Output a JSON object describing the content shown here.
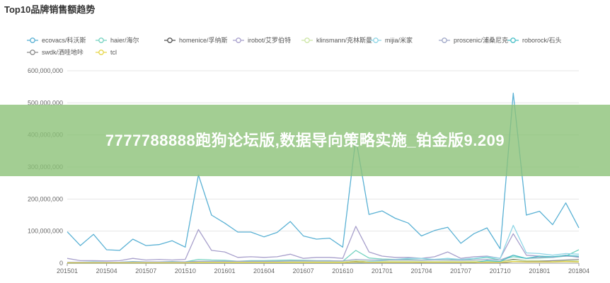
{
  "title": "Top10品牌销售额趋势",
  "banner_text": "7777788888跑狗论坛版,数据导向策略实施_铂金版9.209",
  "chart_data": {
    "type": "line",
    "title": "Top10品牌销售额趋势",
    "xlabel": "",
    "ylabel": "",
    "ylim": [
      0,
      600000000
    ],
    "yticks": [
      0,
      100000000,
      200000000,
      300000000,
      400000000,
      500000000,
      600000000
    ],
    "ytick_labels": [
      "0",
      "100,000,000",
      "200,000,000",
      "300,000,000",
      "400,000,000",
      "500,000,000",
      "600,000,000"
    ],
    "xtick_labels": [
      "201501",
      "201504",
      "201507",
      "201510",
      "201601",
      "201604",
      "201607",
      "201610",
      "201701",
      "201704",
      "201707",
      "201710",
      "201801",
      "201804"
    ],
    "grid": "horizontal",
    "legend_position": "top",
    "x": [
      "201501",
      "201502",
      "201503",
      "201504",
      "201505",
      "201506",
      "201507",
      "201508",
      "201509",
      "201510",
      "201511",
      "201512",
      "201601",
      "201602",
      "201603",
      "201604",
      "201605",
      "201606",
      "201607",
      "201608",
      "201609",
      "201610",
      "201611",
      "201612",
      "201701",
      "201702",
      "201703",
      "201704",
      "201705",
      "201706",
      "201707",
      "201708",
      "201709",
      "201710",
      "201711",
      "201712",
      "201801",
      "201802",
      "201803",
      "201804"
    ],
    "series": [
      {
        "name": "ecovacs/科沃斯",
        "color": "#5ab1d4",
        "values": [
          98000000,
          55000000,
          90000000,
          42000000,
          40000000,
          75000000,
          55000000,
          58000000,
          70000000,
          50000000,
          275000000,
          150000000,
          125000000,
          97000000,
          97000000,
          82000000,
          96000000,
          130000000,
          85000000,
          75000000,
          78000000,
          50000000,
          390000000,
          152000000,
          163000000,
          140000000,
          125000000,
          85000000,
          102000000,
          112000000,
          62000000,
          92000000,
          110000000,
          45000000,
          530000000,
          150000000,
          162000000,
          120000000,
          188000000,
          110000000
        ]
      },
      {
        "name": "haier/海尔",
        "color": "#76d3c1",
        "values": [
          3000000,
          3000000,
          4000000,
          3000000,
          3000000,
          5000000,
          4000000,
          4000000,
          5000000,
          4000000,
          12000000,
          10000000,
          9000000,
          6000000,
          8000000,
          8000000,
          9000000,
          10000000,
          9000000,
          8000000,
          8000000,
          6000000,
          40000000,
          16000000,
          13000000,
          12000000,
          12000000,
          10000000,
          12000000,
          14000000,
          9000000,
          14000000,
          18000000,
          10000000,
          20000000,
          15000000,
          16000000,
          18000000,
          22000000,
          42000000
        ]
      },
      {
        "name": "homenice/孚纳斯",
        "color": "#555555",
        "values": [
          1000000,
          1000000,
          1000000,
          1000000,
          1000000,
          1000000,
          1000000,
          1000000,
          1000000,
          1000000,
          2000000,
          2000000,
          2000000,
          2000000,
          2000000,
          2000000,
          2000000,
          3000000,
          3000000,
          3000000,
          3000000,
          3000000,
          5000000,
          4000000,
          4000000,
          4000000,
          4000000,
          3000000,
          4000000,
          4000000,
          4000000,
          5000000,
          6000000,
          5000000,
          12000000,
          8000000,
          7000000,
          6000000,
          7000000,
          6000000
        ]
      },
      {
        "name": "irobot/艾罗伯特",
        "color": "#a8a0cc",
        "values": [
          15000000,
          8000000,
          8000000,
          7000000,
          8000000,
          15000000,
          10000000,
          12000000,
          10000000,
          12000000,
          105000000,
          40000000,
          35000000,
          18000000,
          20000000,
          18000000,
          20000000,
          28000000,
          15000000,
          18000000,
          18000000,
          15000000,
          115000000,
          35000000,
          22000000,
          18000000,
          18000000,
          15000000,
          20000000,
          35000000,
          15000000,
          20000000,
          22000000,
          15000000,
          92000000,
          25000000,
          22000000,
          18000000,
          25000000,
          18000000
        ]
      },
      {
        "name": "klinsmann/克林斯曼",
        "color": "#cde6a6",
        "values": [
          2000000,
          2000000,
          2000000,
          2000000,
          2000000,
          3000000,
          3000000,
          3000000,
          3000000,
          3000000,
          5000000,
          4000000,
          4000000,
          4000000,
          4000000,
          4000000,
          4000000,
          4000000,
          4000000,
          4000000,
          4000000,
          4000000,
          8000000,
          6000000,
          6000000,
          6000000,
          6000000,
          5000000,
          5000000,
          6000000,
          5000000,
          6000000,
          6000000,
          5000000,
          10000000,
          8000000,
          8000000,
          7000000,
          8000000,
          7000000
        ]
      },
      {
        "name": "mijia/米家",
        "color": "#8fd6e6",
        "values": [
          0,
          0,
          0,
          0,
          0,
          0,
          0,
          0,
          0,
          0,
          0,
          0,
          0,
          0,
          0,
          0,
          0,
          0,
          0,
          0,
          0,
          0,
          0,
          5000000,
          8000000,
          12000000,
          15000000,
          15000000,
          12000000,
          15000000,
          12000000,
          15000000,
          20000000,
          15000000,
          118000000,
          32000000,
          30000000,
          25000000,
          30000000,
          28000000
        ]
      },
      {
        "name": "proscenic/浦桑尼克",
        "color": "#a0a8c8",
        "values": [
          3000000,
          3000000,
          3000000,
          3000000,
          3000000,
          4000000,
          4000000,
          4000000,
          4000000,
          4000000,
          6000000,
          6000000,
          6000000,
          6000000,
          6000000,
          6000000,
          6000000,
          7000000,
          7000000,
          7000000,
          7000000,
          7000000,
          12000000,
          10000000,
          10000000,
          10000000,
          10000000,
          9000000,
          10000000,
          10000000,
          9000000,
          10000000,
          12000000,
          10000000,
          25000000,
          15000000,
          18000000,
          20000000,
          22000000,
          20000000
        ]
      },
      {
        "name": "roborock/石头",
        "color": "#4ac0c8",
        "values": [
          0,
          0,
          0,
          0,
          0,
          0,
          0,
          0,
          0,
          0,
          0,
          0,
          0,
          0,
          0,
          0,
          0,
          0,
          0,
          0,
          0,
          0,
          0,
          0,
          0,
          0,
          0,
          0,
          0,
          0,
          0,
          2000000,
          8000000,
          5000000,
          25000000,
          15000000,
          22000000,
          20000000,
          24000000,
          22000000
        ]
      },
      {
        "name": "swdk/洒哇地咔",
        "color": "#8c8c8c",
        "values": [
          0,
          0,
          0,
          0,
          0,
          0,
          0,
          0,
          0,
          0,
          0,
          0,
          0,
          0,
          0,
          0,
          0,
          0,
          0,
          0,
          0,
          0,
          0,
          0,
          0,
          0,
          0,
          0,
          0,
          0,
          0,
          0,
          0,
          0,
          5000000,
          5000000,
          6000000,
          8000000,
          10000000,
          12000000
        ]
      },
      {
        "name": "tcl",
        "color": "#e6d64a",
        "values": [
          1000000,
          1000000,
          1000000,
          1000000,
          1000000,
          1000000,
          1000000,
          1000000,
          1000000,
          1000000,
          2000000,
          2000000,
          2000000,
          2000000,
          2000000,
          2000000,
          2000000,
          2000000,
          2000000,
          2000000,
          2000000,
          2000000,
          4000000,
          3000000,
          3000000,
          3000000,
          3000000,
          3000000,
          3000000,
          3000000,
          3000000,
          3000000,
          3000000,
          3000000,
          5000000,
          4000000,
          4000000,
          4000000,
          5000000,
          4000000
        ]
      }
    ]
  }
}
